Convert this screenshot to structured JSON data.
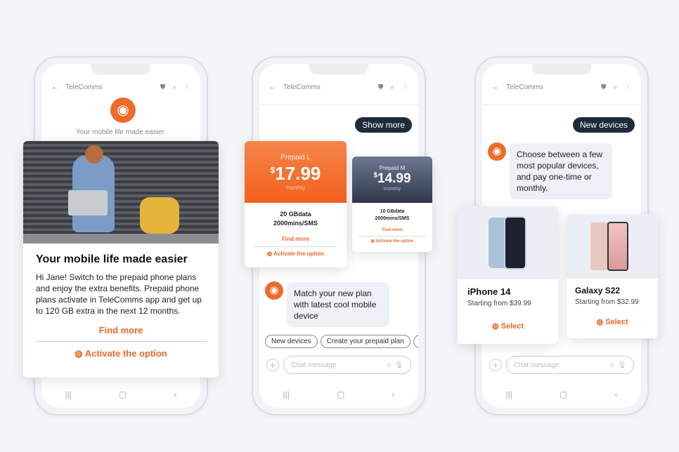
{
  "common": {
    "app_title": "TeleComms",
    "chat_placeholder": "Chat message"
  },
  "phone1": {
    "tagline": "Your mobile life made easier.",
    "card": {
      "title": "Your mobile life made easier",
      "body": "Hi Jane! Switch to the prepaid phone plans and enjoy the extra benefits. Prepaid phone plans activate in TeleComms app and get up to 120 GB extra in the next 12 months.",
      "find_more": "Find more",
      "activate": "Activate the option"
    }
  },
  "phone2": {
    "pill": "Show more",
    "plans": [
      {
        "name": "Prepaid L",
        "currency": "$",
        "price": "17.99",
        "period": "monthly",
        "data": "20 GBdata",
        "mins": "2000mins/SMS",
        "find_more": "Find more",
        "activate": "Activate the option",
        "color": "#f26b2a"
      },
      {
        "name": "Prepaid M",
        "currency": "$",
        "price": "14.99",
        "period": "monthly",
        "data": "10 GBdata",
        "mins": "2000mins/SMS",
        "find_more": "Find more",
        "activate": "Activate the option",
        "color": "#3b4558"
      }
    ],
    "bubble": "Match your new plan with latest cool mobile device",
    "chips": [
      "New devices",
      "Create your prepaid plan",
      "C"
    ]
  },
  "phone3": {
    "pill": "New devices",
    "bubble": "Choose between a few most popular devices, and pay one-time or monthly.",
    "devices": [
      {
        "name": "iPhone 14",
        "price": "Starting from $39.99",
        "select": "Select"
      },
      {
        "name": "Galaxy S22",
        "price": "Starting from $32.99",
        "select": "Select"
      }
    ]
  },
  "colors": {
    "accent": "#e8692a",
    "dark": "#1f2a3a"
  }
}
